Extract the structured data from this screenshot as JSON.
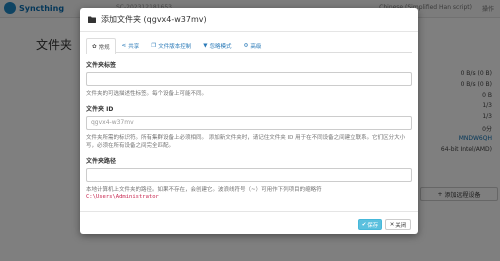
{
  "app": {
    "brand": "Syncthing",
    "device_id": "SC-202312181653",
    "language": "Chinese (Simplified Han script)",
    "actions": "操作"
  },
  "page": {
    "title": "文件夹",
    "right_list": [
      "0 B/s (0 B)",
      "0 B/s (0 B)",
      "0 B",
      "1/3",
      "1/3",
      "0分",
      "MNDW6QH",
      "64-bit Intel/AMD)"
    ],
    "add_device_label": "添加远程设备"
  },
  "modal": {
    "title": "添加文件夹 (qgvx4-w37mv)",
    "tabs": [
      {
        "label": "常规",
        "icon": "gear-icon",
        "active": true
      },
      {
        "label": "共享",
        "icon": "share-icon",
        "active": false
      },
      {
        "label": "文件版本控制",
        "icon": "copy-icon",
        "active": false
      },
      {
        "label": "忽略模式",
        "icon": "filter-icon",
        "active": false
      },
      {
        "label": "高级",
        "icon": "cogs-icon",
        "active": false
      }
    ],
    "fields": {
      "label": {
        "title": "文件夹标签",
        "value": "",
        "help": "文件夹的可选描述性标签。每个设备上可能不同。"
      },
      "id": {
        "title": "文件夹 ID",
        "placeholder": "qgvx4-w37mv",
        "help": "文件夹所需的标识符。所有集群设备上必须相同。 添加新文件夹时，请记住文件夹 ID 用于在不同设备之间建立联系。它们区分大小写，必须在所有设备之间完全匹配。"
      },
      "path": {
        "title": "文件夹路径",
        "value": "",
        "help": "本地计算机上文件夹的路径。如果不存在，会创建它。波浪线符号（~）可用作下列项目的缩略符",
        "code": "C:\\Users\\Administrator"
      }
    },
    "footer": {
      "save": "保存",
      "close": "关闭"
    }
  },
  "colors": {
    "brand_blue": "#0a6fb3",
    "link_blue": "#2a7ab8",
    "save_button": "#5bc0de",
    "code_red": "#c7254e"
  }
}
